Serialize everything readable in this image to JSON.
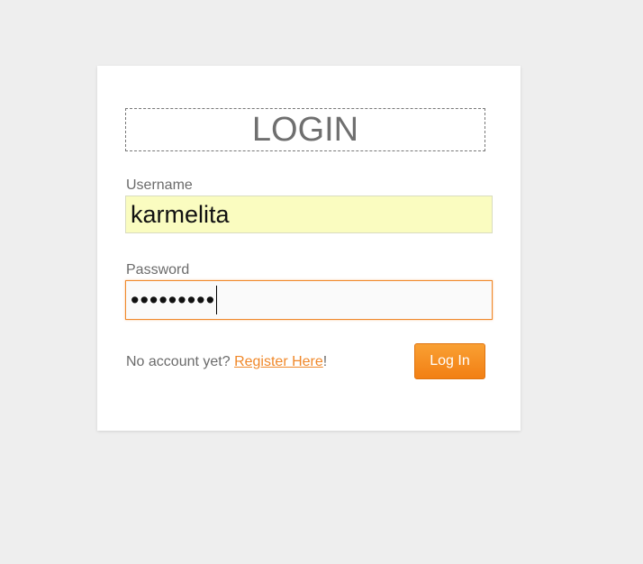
{
  "login": {
    "title": "LOGIN",
    "username_label": "Username",
    "username_value": "karmelita",
    "password_label": "Password",
    "password_masked": "•••••••••",
    "footer_prefix": "No account yet? ",
    "register_link": "Register Here",
    "footer_suffix": "!",
    "submit_label": "Log In"
  },
  "colors": {
    "page_background": "#eeeeee",
    "accent": "#f0882a",
    "autofill_background": "#fafcc0"
  }
}
